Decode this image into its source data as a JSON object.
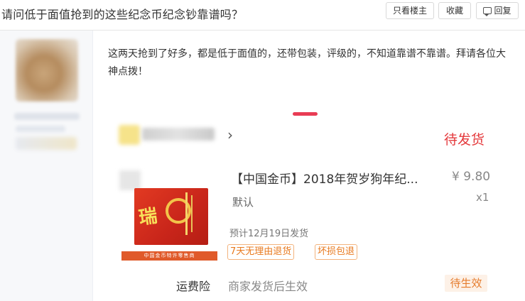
{
  "header": {
    "title": "请问低于面值抢到的这些纪念币纪念钞靠谱吗？",
    "buttons": {
      "owner_only": "只看楼主",
      "favorite": "收藏",
      "reply": "回复"
    }
  },
  "post": {
    "body": "这两天抢到了好多，都是低于面值的，还带包装，评级的，不知道靠谱不靠谱。拜请各位大神点拨！"
  },
  "order": {
    "status": "待发货",
    "product": {
      "title": "【中国金币】2018年贺岁狗年纪...",
      "price": "¥ 9.80",
      "spec": "默认",
      "quantity": "x1",
      "ship_date": "预计12月19日发货",
      "tags": [
        "7天无理由退货",
        "坏损包退"
      ],
      "image_band": "中国金币特许零售商"
    },
    "insurance": {
      "label": "运费险",
      "description": "商家发货后生效",
      "status": "待生效"
    }
  },
  "icons": [
    "reply-icon",
    "chevron-right-icon"
  ],
  "colors": {
    "status_red": "#e4393c",
    "tag_orange": "#e8791e",
    "indicator": "#e93c54"
  }
}
